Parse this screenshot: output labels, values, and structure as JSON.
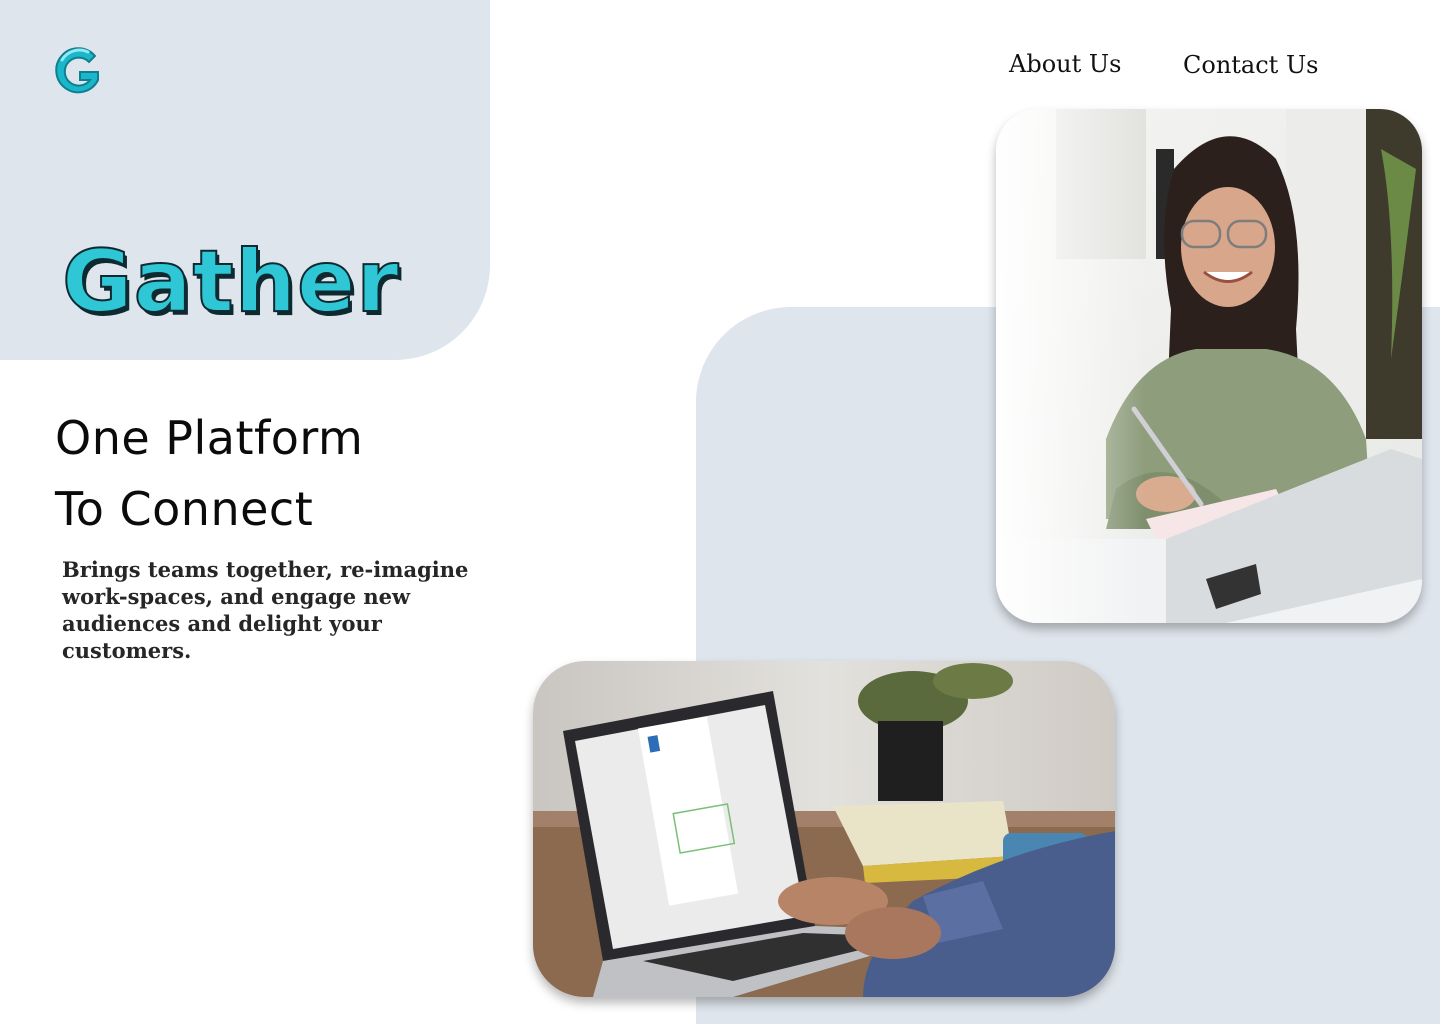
{
  "brand": {
    "logo_icon": "gather-g-logo-icon",
    "name": "Gather",
    "colors": {
      "brand": "#2fc6d6",
      "panel": "#dee5ec",
      "text": "#0b0b0b"
    }
  },
  "nav": {
    "items": [
      {
        "label": "About Us"
      },
      {
        "label": "Contact Us"
      }
    ]
  },
  "hero": {
    "headline_line1": "One Platform",
    "headline_line2": "To Connect",
    "tagline": "Brings teams together, re-imagine work-spaces, and engage new audiences and delight your customers."
  },
  "images": {
    "woman": {
      "alt": "woman-writing-at-laptop-photo"
    },
    "laptop": {
      "alt": "person-typing-on-laptop-photo"
    }
  }
}
